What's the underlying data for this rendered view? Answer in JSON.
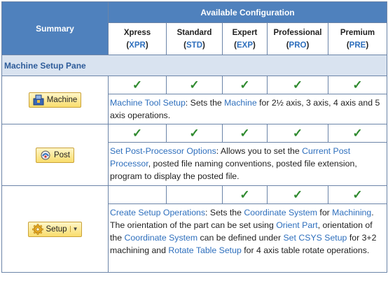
{
  "header": {
    "summary": "Summary",
    "available": "Available Configuration",
    "columns": [
      {
        "name": "Xpress",
        "code": "XPR"
      },
      {
        "name": "Standard",
        "code": "STD"
      },
      {
        "name": "Expert",
        "code": "EXP"
      },
      {
        "name": "Professional",
        "code": "PRO"
      },
      {
        "name": "Premium",
        "code": "PRE"
      }
    ]
  },
  "section": {
    "title": "Machine Setup Pane"
  },
  "check_mark": "✓",
  "rows": [
    {
      "button": {
        "label": "Machine",
        "icon": "machine-icon"
      },
      "checks": [
        true,
        true,
        true,
        true,
        true
      ],
      "desc": [
        {
          "t": "Machine Tool Setup",
          "link": true
        },
        {
          "t": ": Sets the ",
          "link": false
        },
        {
          "t": "Machine",
          "link": true
        },
        {
          "t": " for 2½ axis, 3 axis, 4 axis and 5 axis operations.",
          "link": false
        }
      ]
    },
    {
      "button": {
        "label": "Post",
        "icon": "post-icon"
      },
      "checks": [
        true,
        true,
        true,
        true,
        true
      ],
      "desc": [
        {
          "t": "Set Post-Processor Options",
          "link": true
        },
        {
          "t": ": Allows you to set the ",
          "link": false
        },
        {
          "t": "Current Post Processor",
          "link": true
        },
        {
          "t": ", posted file naming conventions, posted file extension, program to display the posted file.",
          "link": false
        }
      ]
    },
    {
      "button": {
        "label": "Setup",
        "icon": "setup-gear-icon",
        "dropdown": true
      },
      "checks": [
        false,
        false,
        true,
        true,
        true
      ],
      "desc": [
        {
          "t": "Create Setup Operations",
          "link": true
        },
        {
          "t": ": Sets the ",
          "link": false
        },
        {
          "t": "Coordinate System",
          "link": true
        },
        {
          "t": " for ",
          "link": false
        },
        {
          "t": "Machining",
          "link": true
        },
        {
          "t": ". The orientation of the part can be set using ",
          "link": false
        },
        {
          "t": "Orient Part",
          "link": true
        },
        {
          "t": ", orientation of the ",
          "link": false
        },
        {
          "t": "Coordinate System",
          "link": true
        },
        {
          "t": " can be defined under ",
          "link": false
        },
        {
          "t": "Set CSYS Setup",
          "link": true
        },
        {
          "t": " for 3+2 machining and ",
          "link": false
        },
        {
          "t": "Rotate Table Setup",
          "link": true
        },
        {
          "t": " for 4 axis table rotate operations.",
          "link": false
        }
      ]
    }
  ]
}
